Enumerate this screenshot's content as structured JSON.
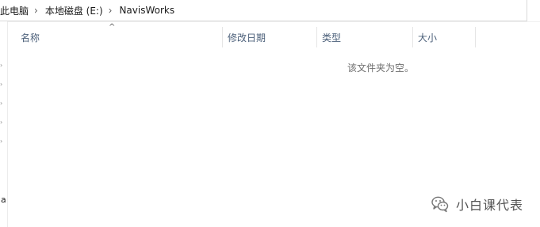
{
  "breadcrumb": {
    "items": [
      "此电脑",
      "本地磁盘 (E:)",
      "NavisWorks"
    ],
    "separator": "›"
  },
  "columns": {
    "name": "名称",
    "modified": "修改日期",
    "type": "类型",
    "size": "大小"
  },
  "sort_indicator": "^",
  "empty_message": "该文件夹为空。",
  "nav_pane": {
    "partial_letter": "a"
  },
  "watermark": {
    "text": "小白课代表",
    "logo_icon": "wechat-icon"
  }
}
